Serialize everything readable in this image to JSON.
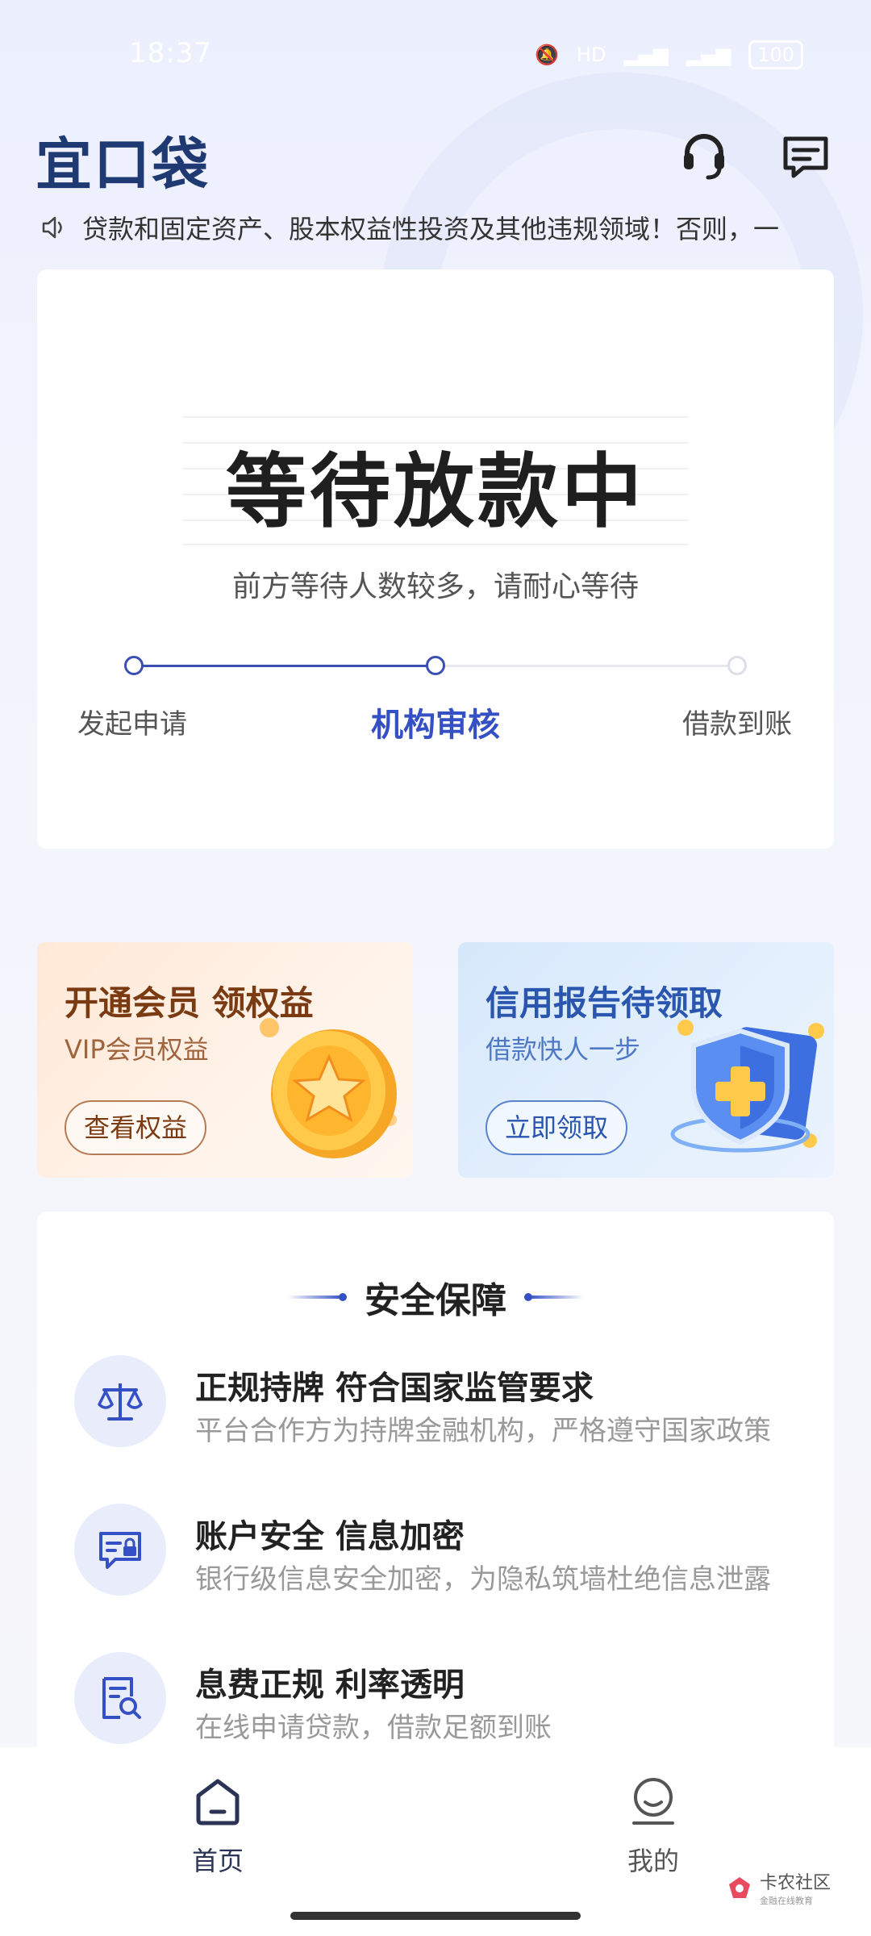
{
  "status_bar": {
    "time": "18:37",
    "icons": [
      "mute-icon",
      "hd-icon",
      "signal-icon",
      "signal-icon"
    ],
    "battery": "100"
  },
  "header": {
    "logo": "宜口袋",
    "icons": [
      "headset-icon",
      "message-icon"
    ]
  },
  "notice": {
    "text": "贷款和固定资产、股本权益性投资及其他违规领域！否则，一"
  },
  "status_card": {
    "title": "等待放款中",
    "subtitle": "前方等待人数较多，请耐心等待",
    "steps": [
      {
        "label": "发起申请",
        "state": "done"
      },
      {
        "label": "机构审核",
        "state": "current"
      },
      {
        "label": "借款到账",
        "state": "pending"
      }
    ],
    "accent_color": "#3550c4"
  },
  "promos": {
    "vip": {
      "title": "开通会员 领权益",
      "subtitle": "VIP会员权益",
      "button": "查看权益"
    },
    "credit": {
      "title": "信用报告待领取",
      "subtitle": "借款快人一步",
      "button": "立即领取"
    }
  },
  "security": {
    "title": "安全保障",
    "items": [
      {
        "icon": "scale-icon",
        "title": "正规持牌 符合国家监管要求",
        "desc": "平台合作方为持牌金融机构，严格遵守国家政策"
      },
      {
        "icon": "secure-card-icon",
        "title": "账户安全 信息加密",
        "desc": "银行级信息安全加密，为隐私筑墙杜绝信息泄露"
      },
      {
        "icon": "document-search-icon",
        "title": "息费正规  利率透明",
        "desc": "在线申请贷款，借款足额到账"
      }
    ]
  },
  "bottom_nav": {
    "items": [
      {
        "label": "首页",
        "icon": "home-icon",
        "active": true
      },
      {
        "label": "我的",
        "icon": "profile-icon",
        "active": false
      }
    ]
  },
  "watermark": {
    "main": "卡农社区",
    "sub": "金融在线教育"
  }
}
